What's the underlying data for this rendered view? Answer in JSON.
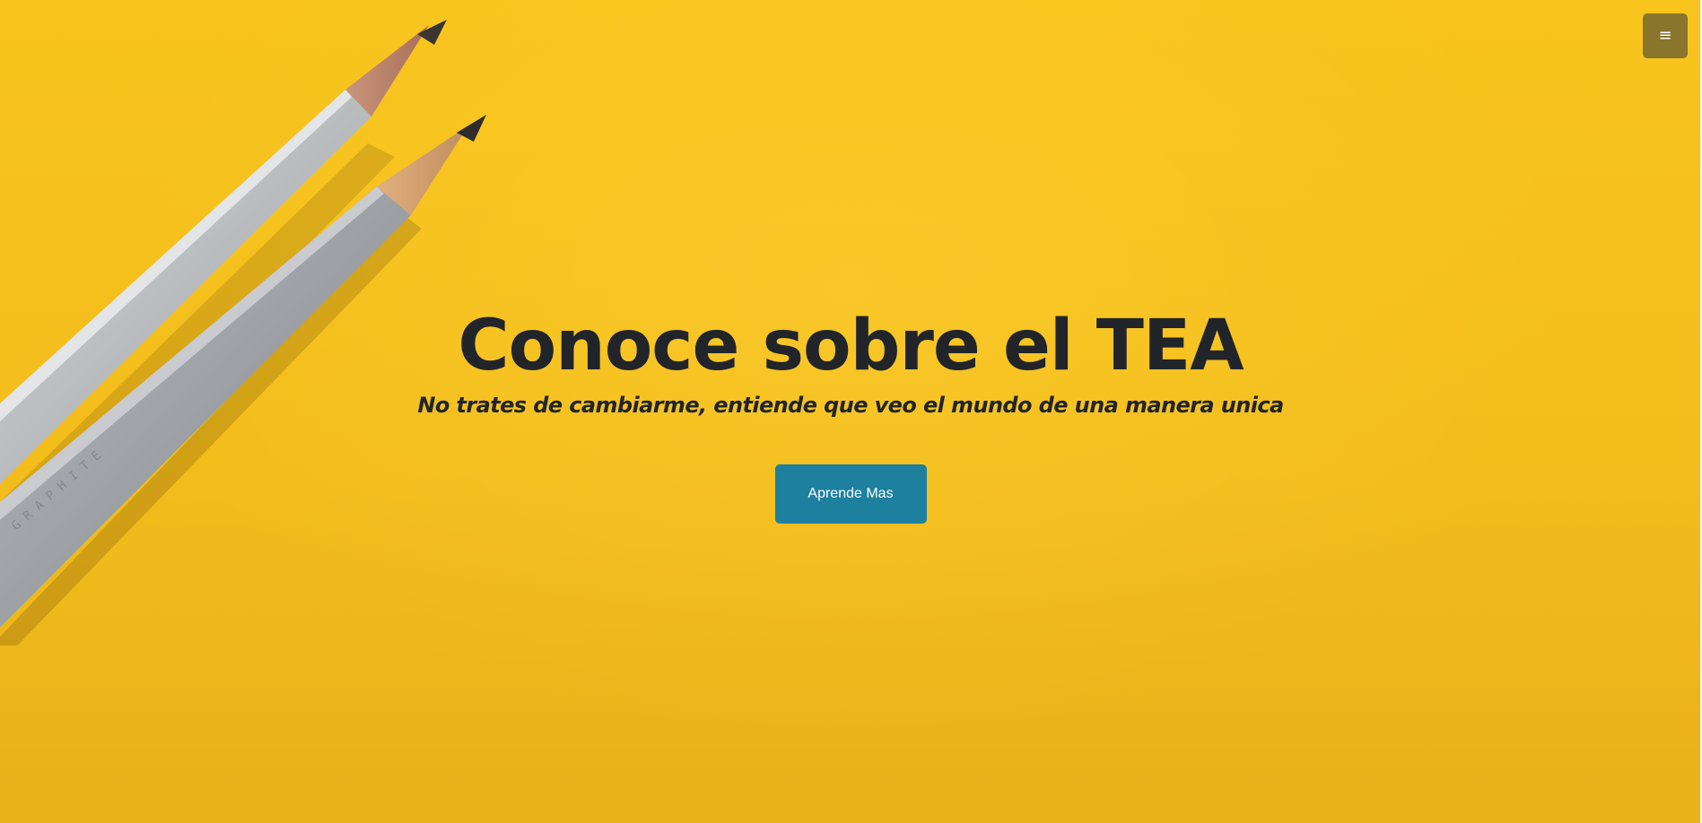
{
  "menu": {
    "icon": "hamburger-menu-icon",
    "glyph": "≡"
  },
  "hero": {
    "title": "Conoce sobre el TEA",
    "subtitle": "No trates de cambiarme, entiende que veo el mundo de una manera unica",
    "cta_label": "Aprende Mas",
    "illustration": "two-gray-pencils-image"
  },
  "colors": {
    "background": "#f6c21d",
    "title_text": "#212529",
    "cta_background": "#1d809f",
    "cta_text": "#ffffff",
    "menu_background": "#89752c"
  }
}
